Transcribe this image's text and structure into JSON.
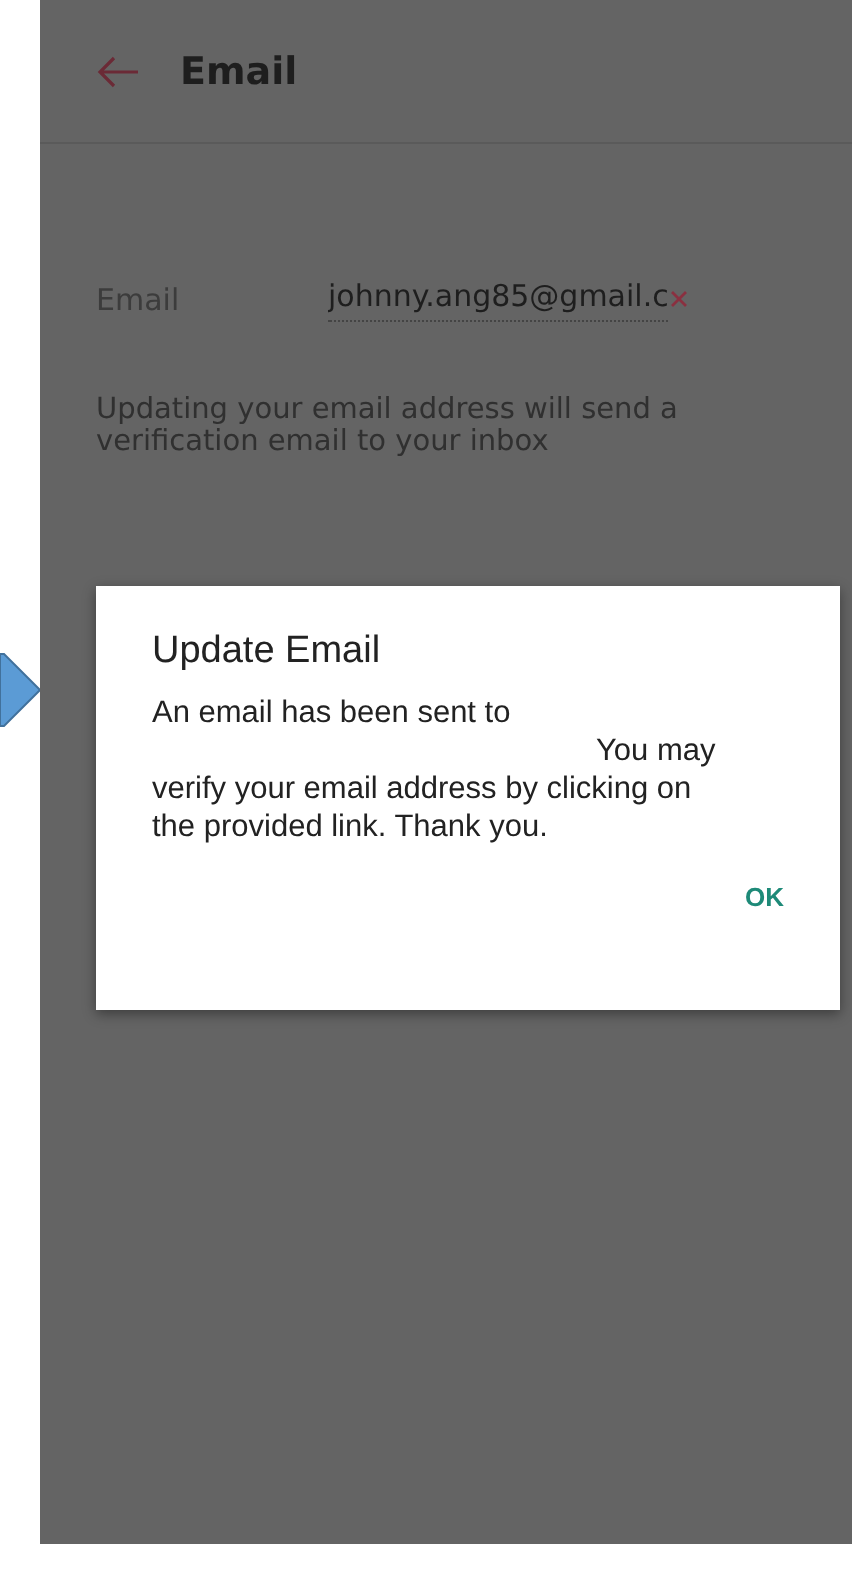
{
  "header": {
    "title": "Email"
  },
  "email_field": {
    "label": "Email",
    "value": "johnny.ang85@gmail.c"
  },
  "helper_text": "Updating your email address will send a verification email to your inbox",
  "dialog": {
    "title": "Update Email",
    "message_start": "An email has been sent to",
    "message_rest": "You may verify your email address by clicking on the provided link. Thank you.",
    "buttons": [
      "OK"
    ]
  }
}
